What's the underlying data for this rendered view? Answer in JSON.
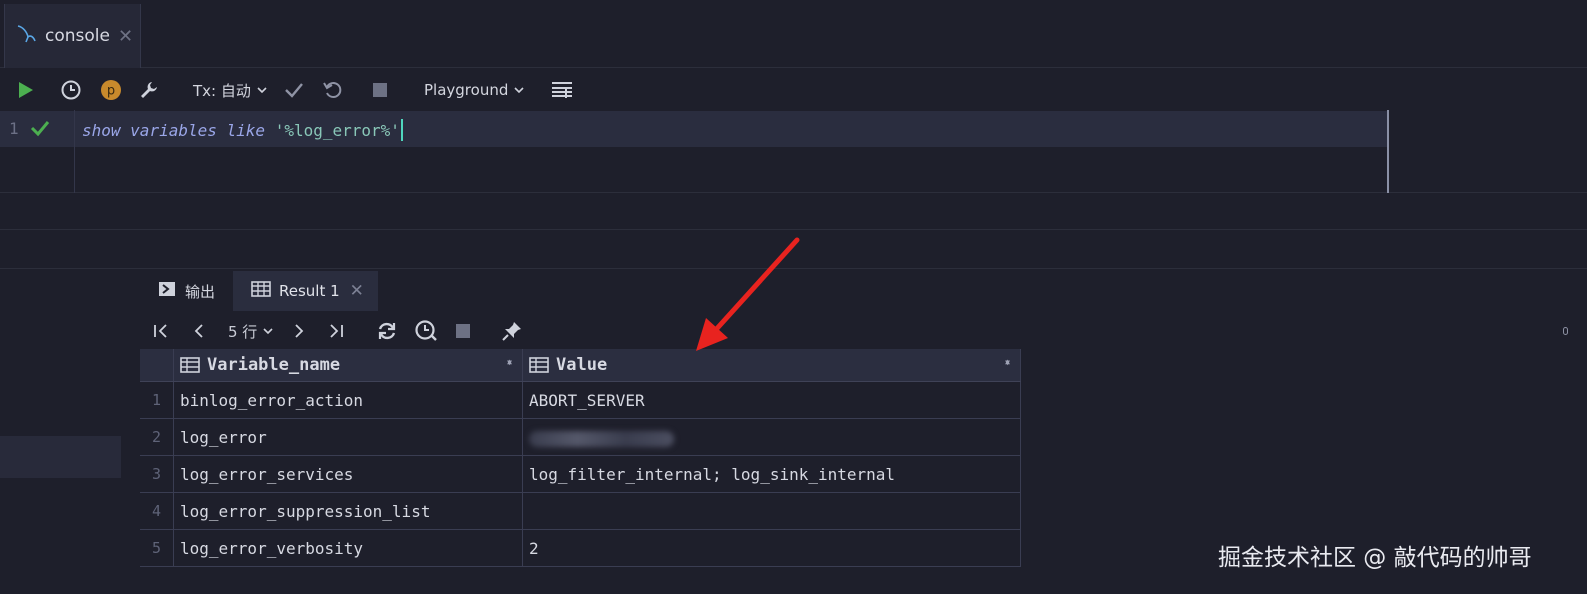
{
  "tab": {
    "label": "console",
    "close": "✕"
  },
  "toolbar": {
    "tx_label": "Tx: 自动",
    "playground_label": "Playground"
  },
  "editor": {
    "line_number": "1",
    "code_kw1": "show",
    "code_kw2": "variables",
    "code_kw3": "like",
    "code_str": "'%log_error%'"
  },
  "result_tabs": {
    "output_label": "输出",
    "result_label": "Result 1",
    "close": "✕"
  },
  "pager": {
    "rows_label": "5 行"
  },
  "grid": {
    "columns": [
      "Variable_name",
      "Value"
    ],
    "rows": [
      {
        "n": "1",
        "name": "binlog_error_action",
        "value": "ABORT_SERVER"
      },
      {
        "n": "2",
        "name": "log_error",
        "value": ""
      },
      {
        "n": "3",
        "name": "log_error_services",
        "value": "log_filter_internal; log_sink_internal"
      },
      {
        "n": "4",
        "name": "log_error_suppression_list",
        "value": ""
      },
      {
        "n": "5",
        "name": "log_error_verbosity",
        "value": "2"
      }
    ]
  },
  "watermark": "掘金技术社区 @ 敲代码的帅哥",
  "colors": {
    "accent": "#4fd6be",
    "run": "#4caf50",
    "arrow": "#e8231f"
  }
}
